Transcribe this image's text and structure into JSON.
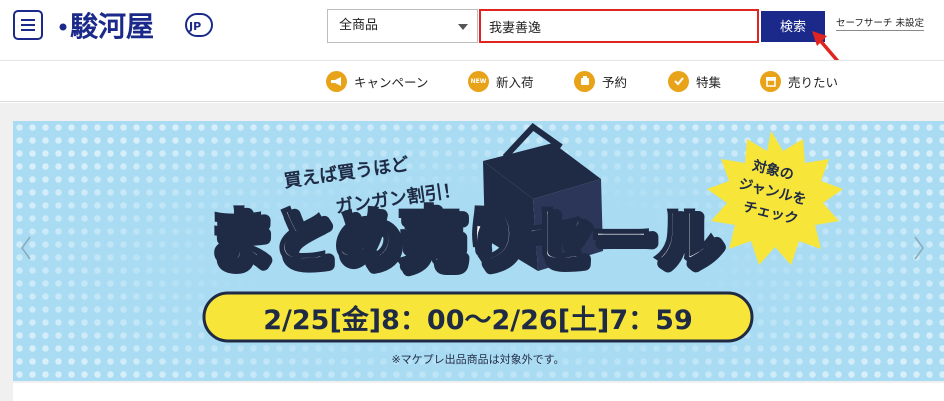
{
  "header": {
    "logo_text": "駿河屋",
    "logo_suffix": "JP",
    "category_select": {
      "selected": "全商品"
    },
    "search": {
      "value": "我妻善逸",
      "placeholder": ""
    },
    "search_button_label": "検索",
    "safe_search_label": "セーフサーチ",
    "safe_search_value": "未設定"
  },
  "nav": {
    "items": [
      {
        "label": "キャンペーン",
        "icon": "megaphone-icon"
      },
      {
        "label": "新入荷",
        "icon": "new-badge-icon"
      },
      {
        "label": "予約",
        "icon": "reservation-hand-icon"
      },
      {
        "label": "特集",
        "icon": "feature-check-icon"
      },
      {
        "label": "売りたい",
        "icon": "store-icon"
      }
    ],
    "new_badge_text": "NEW"
  },
  "banner": {
    "tagline_line1": "買えば買うほど",
    "tagline_line2": "ガンガン割引！",
    "title": "まとめ売りセール",
    "starburst_lines": [
      "対象の",
      "ジャンルを",
      "チェック"
    ],
    "date_range": "2/25[金]8：00～2/26[土]7：59",
    "note": "※マケプレ出品商品は対象外です。",
    "colors": {
      "sky": "#a9dcf3",
      "yellow": "#f7e53a",
      "navy": "#1b2a8a",
      "accent": "#e8a318"
    }
  }
}
